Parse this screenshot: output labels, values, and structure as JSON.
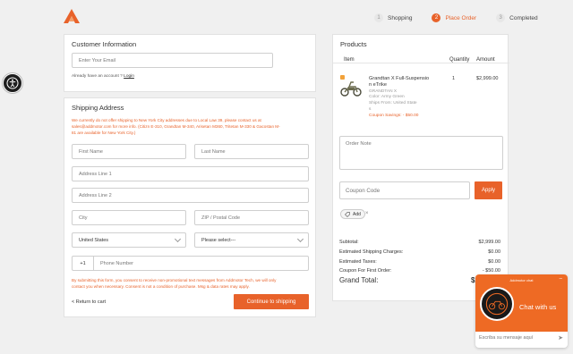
{
  "steps": [
    {
      "num": "1",
      "label": "Shopping"
    },
    {
      "num": "2",
      "label": "Place Order"
    },
    {
      "num": "3",
      "label": "Completed"
    }
  ],
  "customer": {
    "title": "Customer Information",
    "email_placeholder": "Enter Your Email",
    "have_account": "Already have an account ?",
    "login_link": "Login"
  },
  "shipping": {
    "title": "Shipping Address",
    "notice_1": "We currently do not offer shipping to New York City addresses due to Local Law 39, please contact us at",
    "notice_2": "sales@addmotor.com for more info. (Citizn E-310, Grandtan M-340, Arisetan M360, Tritetan M-330 & Gacostan M-",
    "notice_3": "81 are available for New York City.)",
    "first_name": "First Name",
    "last_name": "Last Name",
    "address1": "Address Line 1",
    "address2": "Address Line 2",
    "city": "City",
    "zip": "ZIP / Postal Code",
    "country": "United States",
    "state": "Please select---",
    "phone_code": "+1",
    "phone": "Phone Number",
    "consent_1": "By submitting this form, you consent to receive non-promotional text messages from Addmotor Tech, we will only",
    "consent_2": "contact you when necessary. Consent is not a condition of purchase. Msg & data rates may apply.",
    "return_label": "< Return to cart",
    "continue_label": "Continue to shipping"
  },
  "products": {
    "title": "Products",
    "col_item": "Item",
    "col_qty": "Quantity",
    "col_amount": "Amount",
    "item": {
      "name_1": "Grandtan X Full-Suspensio",
      "name_2": "n eTrike",
      "sku": "GRANDTAN X",
      "color": "Color: Army Green",
      "ships": "Ships From: United State",
      "ships_2": "s",
      "saving": "Coupon Savings: - $50.00",
      "qty": "1",
      "amount": "$2,999.00"
    },
    "order_note": "Order Note",
    "coupon_placeholder": "Coupon Code",
    "apply": "Apply",
    "tag_label": "Add",
    "tag_remove": "×",
    "summary": [
      {
        "label": "Subtotal:",
        "value": "$2,999.00"
      },
      {
        "label": "Estimated Shipping Charges:",
        "value": "$0.00"
      },
      {
        "label": "Estimated Taxes:",
        "value": "$0.00"
      },
      {
        "label": "Coupon For First Order:",
        "value": "- $50.00"
      }
    ],
    "grand_total_label": "Grand Total:",
    "grand_total_value": "$2"
  },
  "chat": {
    "header": "Addmotor chat",
    "minimize": "–",
    "title": "Chat with us",
    "input_placeholder": "Escriba su mensaje aquí"
  },
  "colors": {
    "accent": "#e8622a",
    "chat": "#ee6a24"
  }
}
